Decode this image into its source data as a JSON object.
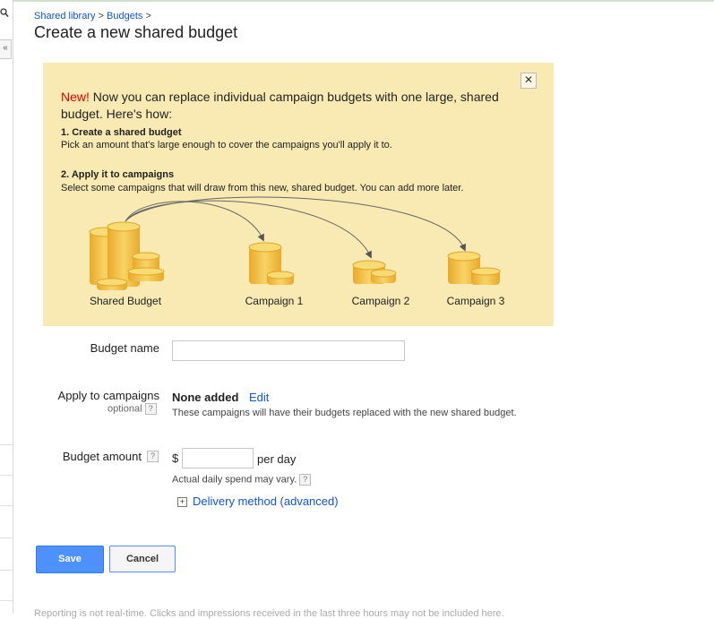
{
  "breadcrumb": {
    "item1": "Shared library",
    "separator1": " > ",
    "item2": "Budgets",
    "separator2": " >"
  },
  "page_title": "Create a new shared budget",
  "left_sidebar": {
    "search_icon": "search-icon",
    "collapse_label": "«"
  },
  "promo": {
    "close_label": "✕",
    "new_label": "New!",
    "intro_text": " Now you can replace individual campaign budgets with one large, shared budget. Here's how:",
    "step1_title": "1. Create a shared budget",
    "step1_desc": "Pick an amount that's large enough to cover the campaigns you'll apply it to.",
    "step2_title": "2. Apply it to campaigns",
    "step2_desc": "Select some campaigns that will draw from this new, shared budget. You can add more later.",
    "labels": [
      "Shared Budget",
      "Campaign 1",
      "Campaign 2",
      "Campaign 3"
    ],
    "colors": {
      "background": "#f9e9b3",
      "coin": "#f4c84a",
      "coin_dark": "#e0a52a",
      "new": "#dd0000"
    }
  },
  "form": {
    "budget_name_label": "Budget name",
    "budget_name_value": "",
    "apply_label": "Apply to campaigns",
    "apply_optional": "optional",
    "apply_value": "None added",
    "apply_edit": "Edit",
    "apply_note": "These campaigns will have their budgets replaced with the new shared budget.",
    "amount_label": "Budget amount",
    "amount_currency": "$",
    "amount_value": "",
    "amount_unit": "per day",
    "amount_note": "Actual daily spend may vary.",
    "help_glyph": "?",
    "delivery_plus": "+",
    "delivery_label": "Delivery method (advanced)"
  },
  "buttons": {
    "save": "Save",
    "cancel": "Cancel"
  },
  "footer": {
    "note": "Reporting is not real-time. Clicks and impressions received in the last three hours may not be included here."
  },
  "accent_color": "#4d90fe",
  "link_color": "#1155cc"
}
